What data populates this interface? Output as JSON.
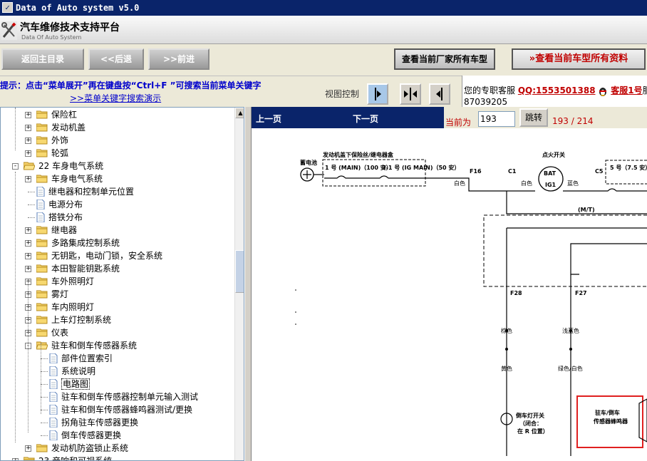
{
  "window": {
    "title": "Data of Auto system v5.0"
  },
  "header": {
    "title": "汽车维修技术支持平台",
    "subtitle": "Data Of Auto System"
  },
  "toolbar": {
    "back_home": "返回主目录",
    "back": "<<后退",
    "forward": ">>前进",
    "all_models": "查看当前厂家所有车型",
    "all_data": "查看当前车型所有资料",
    "all_data_prefix": "»"
  },
  "hint": {
    "line1": "提示：点击“菜单展开”再在键盘按“Ctrl+F ”可搜索当前菜单关键字",
    "line2": ">>菜单关键字搜索演示"
  },
  "view_control": {
    "label": "视图控制"
  },
  "service": {
    "label": "您的专职客服",
    "qq": "QQ:1553501388",
    "agent": "客服1号",
    "agent_suffix": "服",
    "phone": "87039205"
  },
  "tree": {
    "items": [
      {
        "label": "保险杠",
        "kind": "folder",
        "level": 1,
        "expander": "+"
      },
      {
        "label": "发动机盖",
        "kind": "folder",
        "level": 1,
        "expander": "+"
      },
      {
        "label": "外饰",
        "kind": "folder",
        "level": 1,
        "expander": "+"
      },
      {
        "label": "轮弧",
        "kind": "folder",
        "level": 1,
        "expander": "+"
      },
      {
        "label": "22 车身电气系统",
        "kind": "folder-open",
        "level": 0,
        "expander": "-"
      },
      {
        "label": "车身电气系统",
        "kind": "folder",
        "level": 1,
        "expander": "+"
      },
      {
        "label": "继电器和控制单元位置",
        "kind": "doc",
        "level": 1,
        "expander": ""
      },
      {
        "label": "电源分布",
        "kind": "doc",
        "level": 1,
        "expander": ""
      },
      {
        "label": "搭铁分布",
        "kind": "doc",
        "level": 1,
        "expander": ""
      },
      {
        "label": "继电器",
        "kind": "folder",
        "level": 1,
        "expander": "+"
      },
      {
        "label": "多路集成控制系统",
        "kind": "folder",
        "level": 1,
        "expander": "+"
      },
      {
        "label": "无钥匙，电动门锁，安全系统",
        "kind": "folder",
        "level": 1,
        "expander": "+"
      },
      {
        "label": "本田智能钥匙系统",
        "kind": "folder",
        "level": 1,
        "expander": "+"
      },
      {
        "label": "车外照明灯",
        "kind": "folder",
        "level": 1,
        "expander": "+"
      },
      {
        "label": "雾灯",
        "kind": "folder",
        "level": 1,
        "expander": "+"
      },
      {
        "label": "车内照明灯",
        "kind": "folder",
        "level": 1,
        "expander": "+"
      },
      {
        "label": "上车灯控制系统",
        "kind": "folder",
        "level": 1,
        "expander": "+"
      },
      {
        "label": "仪表",
        "kind": "folder",
        "level": 1,
        "expander": "+"
      },
      {
        "label": "驻车和倒车传感器系统",
        "kind": "folder-open",
        "level": 1,
        "expander": "-"
      },
      {
        "label": "部件位置索引",
        "kind": "doc",
        "level": 2,
        "expander": ""
      },
      {
        "label": "系统说明",
        "kind": "doc",
        "level": 2,
        "expander": ""
      },
      {
        "label": "电路图",
        "kind": "doc",
        "level": 2,
        "expander": "",
        "selected": true
      },
      {
        "label": "驻车和倒车传感器控制单元输入测试",
        "kind": "doc",
        "level": 2,
        "expander": ""
      },
      {
        "label": "驻车和倒车传感器蜂鸣器测试/更换",
        "kind": "doc",
        "level": 2,
        "expander": ""
      },
      {
        "label": "拐角驻车传感器更换",
        "kind": "doc",
        "level": 2,
        "expander": ""
      },
      {
        "label": "倒车传感器更换",
        "kind": "doc",
        "level": 2,
        "expander": ""
      },
      {
        "label": "发动机防盗锁止系统",
        "kind": "folder",
        "level": 1,
        "expander": "+"
      },
      {
        "label": "23 音响和可视系统",
        "kind": "folder",
        "level": 0,
        "expander": "+"
      }
    ]
  },
  "viewer": {
    "prev": "上一页",
    "next": "下一页",
    "current_label": "当前为",
    "current_page": "193",
    "jump": "跳转",
    "page_count": "193 / 214"
  },
  "diagram": {
    "battery": "蓄电池",
    "fusebox_title": "发动机盖下保险丝/继电器盒",
    "fuse1": "1 号 (MAIN)（100 安）",
    "fuse2": "3-1 号 (IG MAIN)（50 安）",
    "f16": "F16",
    "c1": "C1",
    "white1": "白色",
    "white2": "白色",
    "ign_switch": "点火开关",
    "bat": "BAT",
    "ig1": "IG1",
    "blue": "蓝色",
    "c5": "C5",
    "fuse5": "5 号（7.5 安）",
    "mt": "(M/T)",
    "f28": "F28",
    "f27": "F27",
    "brown": "棕色",
    "light_blue": "浅蓝色",
    "yellow": "黄色",
    "green_white": "绿色/白色",
    "reverse_switch": "倒车灯开关",
    "closed": "（闭合：",
    "in_r": "在 R 位置）",
    "parking_label1": "驻车/倒车",
    "parking_label2": "传感器蜂鸣器"
  },
  "colors": {
    "titlebar": "#0a246a",
    "accent_red": "#c00000",
    "link_blue": "#0000cc",
    "highlight_box": "#e02020"
  }
}
